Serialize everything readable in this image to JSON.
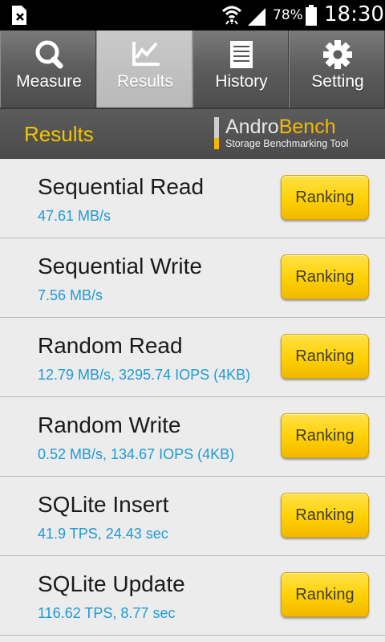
{
  "status_bar": {
    "battery_percent": "78%",
    "time": "18:30",
    "icons": [
      "sim-icon",
      "wifi-icon",
      "signal-icon",
      "battery-icon"
    ]
  },
  "tabs": [
    {
      "label": "Measure",
      "icon": "search-icon",
      "active": false
    },
    {
      "label": "Results",
      "icon": "chart-icon",
      "active": true
    },
    {
      "label": "History",
      "icon": "document-icon",
      "active": false
    },
    {
      "label": "Setting",
      "icon": "gear-icon",
      "active": false
    }
  ],
  "header": {
    "title": "Results",
    "logo_andro": "Andro",
    "logo_bench": "Bench",
    "tagline": "Storage Benchmarking Tool"
  },
  "results": [
    {
      "name": "Sequential Read",
      "value": "47.61 MB/s",
      "button": "Ranking"
    },
    {
      "name": "Sequential Write",
      "value": "7.56 MB/s",
      "button": "Ranking"
    },
    {
      "name": "Random Read",
      "value": "12.79 MB/s, 3295.74 IOPS (4KB)",
      "button": "Ranking"
    },
    {
      "name": "Random Write",
      "value": "0.52 MB/s, 134.67 IOPS (4KB)",
      "button": "Ranking"
    },
    {
      "name": "SQLite Insert",
      "value": "41.9 TPS, 24.43 sec",
      "button": "Ranking"
    },
    {
      "name": "SQLite Update",
      "value": "116.62 TPS, 8.77 sec",
      "button": "Ranking"
    }
  ],
  "colors": {
    "accent_yellow": "#f5c400",
    "value_blue": "#1f9ad6",
    "button_yellow": "#ffd000"
  }
}
